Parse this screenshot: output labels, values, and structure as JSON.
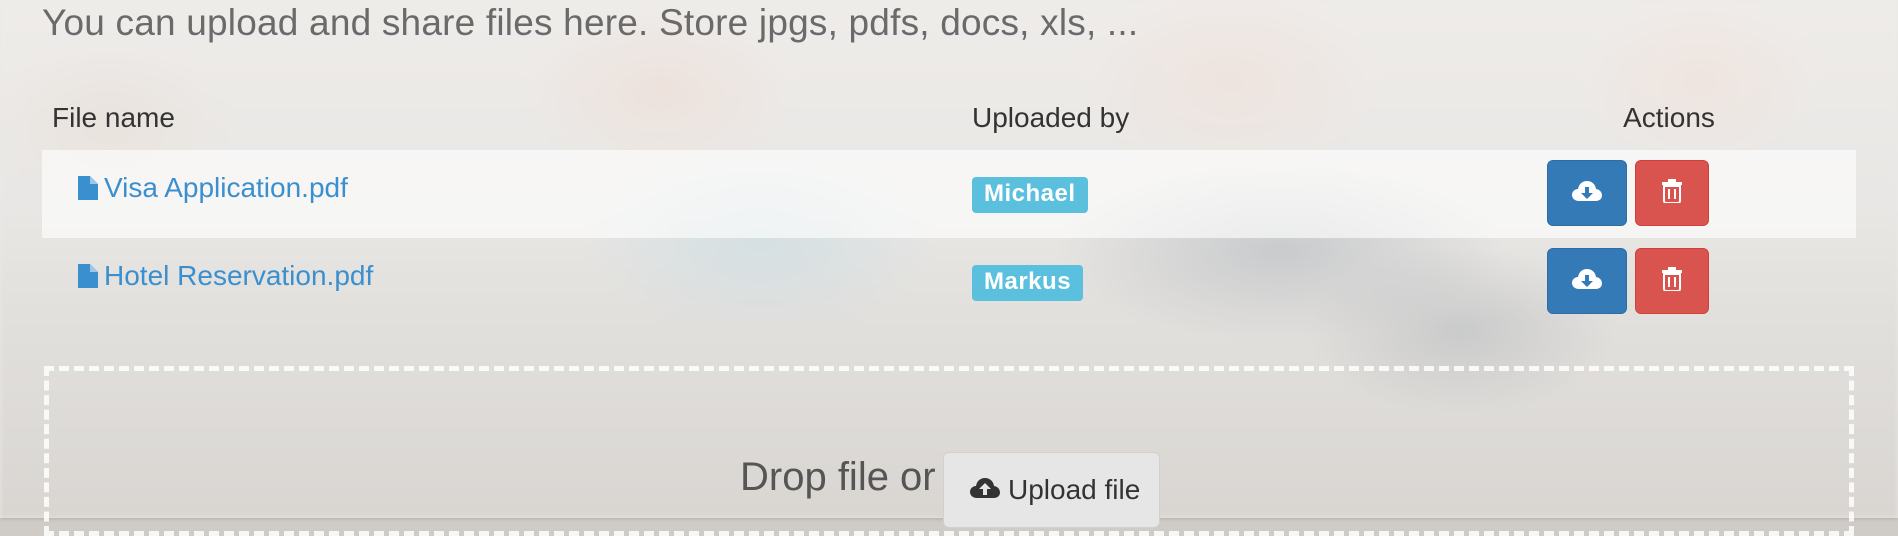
{
  "intro_text": "You can upload and share files here. Store jpgs, pdfs, docs, xls, ...",
  "table": {
    "headers": {
      "file_name": "File name",
      "uploaded_by": "Uploaded by",
      "actions": "Actions"
    },
    "rows": [
      {
        "file_name": "Visa Application.pdf",
        "uploaded_by": "Michael"
      },
      {
        "file_name": "Hotel Reservation.pdf",
        "uploaded_by": "Markus"
      }
    ]
  },
  "icons": {
    "file": "file-icon",
    "download": "cloud-download-icon",
    "delete": "trash-icon",
    "upload": "cloud-upload-icon"
  },
  "colors": {
    "link": "#3a8fcf",
    "badge": "#5bc0de",
    "download_button": "#337ab7",
    "delete_button": "#d9534f",
    "upload_button": "#e6e6e6"
  },
  "dropzone": {
    "text": "Drop file or",
    "upload_label": "Upload file"
  }
}
